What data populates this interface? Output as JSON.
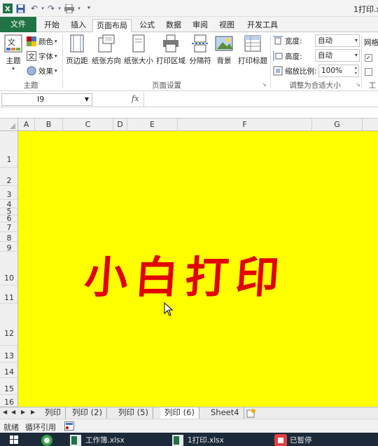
{
  "window": {
    "title": "1打印.x"
  },
  "tabs": [
    "文件",
    "开始",
    "插入",
    "页面布局",
    "公式",
    "数据",
    "审阅",
    "视图",
    "开发工具"
  ],
  "ribbon": {
    "theme_group": {
      "label": "主题",
      "themes": "主题",
      "colors": "颜色",
      "fonts": "字体",
      "effects": "效果"
    },
    "page_setup_group": {
      "label": "页面设置",
      "margins": "页边距",
      "orientation": "纸张方向",
      "size": "纸张大小",
      "print_area": "打印区域",
      "breaks": "分隔符",
      "background": "背景",
      "print_titles": "打印标题"
    },
    "scale_group": {
      "label": "调整为合适大小",
      "width_label": "宽度:",
      "width_value": "自动",
      "height_label": "高度:",
      "height_value": "自动",
      "scale_label": "缩放比例:",
      "scale_value": "100%"
    },
    "sheet_options_group": {
      "label": "工",
      "gridlines": "网格"
    }
  },
  "formula_bar": {
    "name_box": "I9",
    "fx": "fx",
    "formula": ""
  },
  "columns": [
    "A",
    "B",
    "C",
    "D",
    "E",
    "F",
    "G"
  ],
  "rows": [
    "1",
    "2",
    "3",
    "4",
    "5",
    "6",
    "7",
    "8",
    "9",
    "10",
    "11",
    "12",
    "13",
    "14",
    "15",
    "16"
  ],
  "cell_text": "小白打印",
  "sheet_tabs": [
    "列印",
    "列印 (2)",
    "列印 (5)",
    "列印 (6)",
    "Sheet4"
  ],
  "active_sheet": "列印 (6)",
  "status": {
    "ready": "就绪",
    "circular": "循环引用"
  },
  "taskbar": [
    "工作簿.xlsx",
    "1打印.xlsx",
    "已暂停"
  ],
  "colors": {
    "sheet_fill": "#ffff00",
    "banner_text": "#e00000",
    "excel_green": "#217346"
  }
}
